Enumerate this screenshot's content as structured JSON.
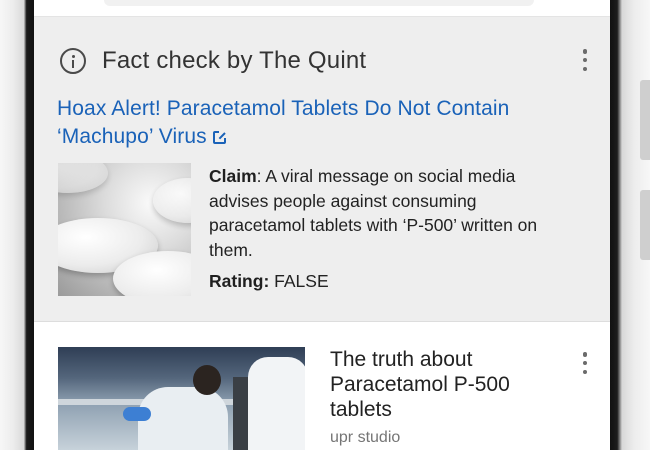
{
  "fact_check": {
    "title": "Fact check by The Quint",
    "headline": "Hoax Alert! Paracetamol Tablets Do Not Contain ‘Machupo’ Virus",
    "claim_label": "Claim",
    "claim_text": ": A viral message on social media advises people against consuming paracetamol tablets with ‘P-500’ written on them.",
    "rating_label": "Rating:",
    "rating_value": " FALSE",
    "icons": {
      "info": "info-icon",
      "external_link": "external-link-icon",
      "more": "more-vert-icon"
    },
    "colors": {
      "headline": "#1a62b8",
      "background": "#eeeeee"
    }
  },
  "article": {
    "title": "The truth about Paracetamol P-500 tablets",
    "source": "upr studio",
    "icons": {
      "more": "more-vert-icon"
    }
  }
}
